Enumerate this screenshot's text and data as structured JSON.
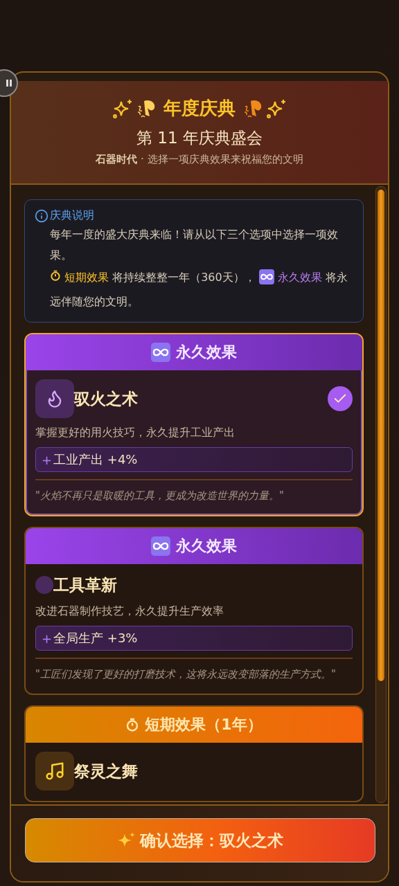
{
  "header": {
    "title": "年度庆典",
    "subtitle": "第 11 年庆典盛会",
    "description": "**石器时代** · 选择一项庆典效果来祝福您的文明"
  },
  "info": {
    "title": "庆典说明",
    "text": "每年一度的盛大庆典来临！请从以下三个选项中选择一项效果。",
    "legend": [
      {
        "kind": "short",
        "text": "短期效果"
      },
      {
        "kind": "plain",
        "text": "将持续整整一年（360天），"
      },
      {
        "kind": "permanent",
        "text": "永久效果"
      },
      {
        "kind": "plain",
        "text": "将永远伴随您的文明。"
      }
    ]
  },
  "options": [
    {
      "kind": "permanent",
      "badge": "永久效果",
      "name": "驭火之术",
      "selected": true,
      "description": "掌握更好的用火技巧，永久提升工业产出",
      "effect_sign": "+",
      "effect": "工业产出 +4%",
      "quote": "\"火焰不再只是取暖的工具，更成为改造世界的力量。\""
    },
    {
      "kind": "permanent",
      "badge": "永久效果",
      "name": "工具革新",
      "selected": false,
      "description": "改进石器制作技艺，永久提升生产效率",
      "effect_sign": "+",
      "effect": "全局生产 +3%",
      "quote": "\"工匠们发现了更好的打磨技术，这将永远改变部落的生产方式。\""
    },
    {
      "kind": "short",
      "badge": "短期效果（1年）",
      "name": "祭灵之舞",
      "selected": false
    }
  ],
  "confirm_button": "确认选择：驭火之术"
}
